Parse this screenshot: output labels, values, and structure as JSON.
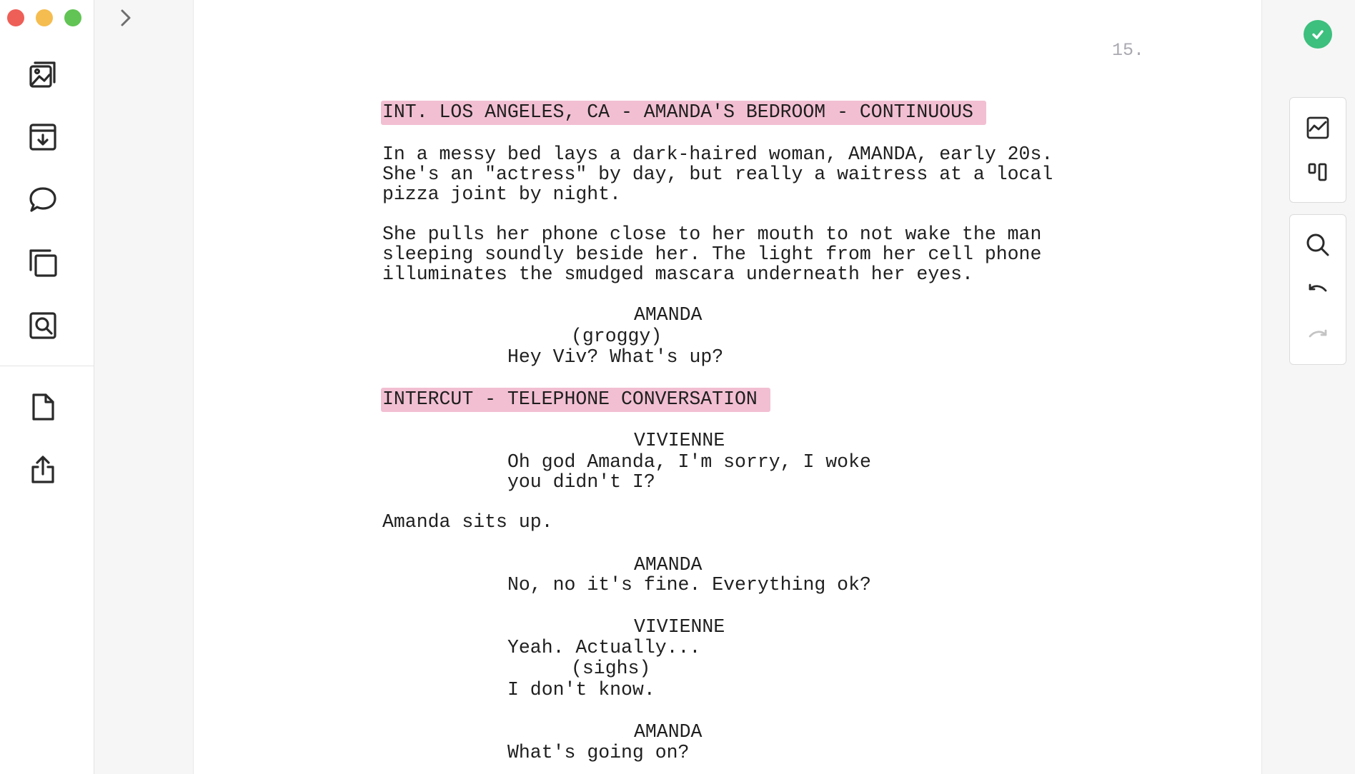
{
  "colors": {
    "scene_highlight": "#f2bfd2",
    "page_number": "#a9a9b0",
    "status_ok": "#3dbf7e",
    "text": "#1f1f1f"
  },
  "sidebar": {
    "items": [
      {
        "name": "images-icon"
      },
      {
        "name": "download-archive-icon"
      },
      {
        "name": "comment-icon"
      },
      {
        "name": "copy-icon"
      },
      {
        "name": "find-in-document-icon"
      },
      {
        "name": "document-icon"
      },
      {
        "name": "share-icon"
      }
    ]
  },
  "right_toolbar": {
    "status": "saved-check-icon",
    "group1": [
      "chart-icon",
      "layout-columns-icon"
    ],
    "group2": [
      "search-icon",
      "undo-icon",
      "redo-icon"
    ]
  },
  "script": {
    "page_number": "15.",
    "lines": [
      {
        "type": "scene",
        "text": "INT. LOS ANGELES, CA - AMANDA'S BEDROOM - CONTINUOUS"
      },
      {
        "type": "action",
        "text": "In a messy bed lays a dark-haired woman, AMANDA, early 20s."
      },
      {
        "type": "action",
        "text": "She's an \"actress\" by day, but really a waitress at a local"
      },
      {
        "type": "action",
        "text": "pizza joint by night."
      },
      {
        "type": "action",
        "text": "She pulls her phone close to her mouth to not wake the man"
      },
      {
        "type": "action",
        "text": "sleeping soundly beside her. The light from her cell phone"
      },
      {
        "type": "action",
        "text": "illuminates the smudged mascara underneath her eyes."
      },
      {
        "type": "character",
        "text": "AMANDA"
      },
      {
        "type": "parenthetical",
        "text": "(groggy)"
      },
      {
        "type": "dialogue",
        "text": "Hey Viv? What's up?"
      },
      {
        "type": "scene",
        "text": "INTERCUT - TELEPHONE CONVERSATION"
      },
      {
        "type": "character",
        "text": "VIVIENNE"
      },
      {
        "type": "dialogue",
        "text": "Oh god Amanda, I'm sorry, I woke"
      },
      {
        "type": "dialogue",
        "text": "you didn't I?"
      },
      {
        "type": "action",
        "text": "Amanda sits up."
      },
      {
        "type": "character",
        "text": "AMANDA"
      },
      {
        "type": "dialogue",
        "text": "No, no it's fine. Everything ok?"
      },
      {
        "type": "character",
        "text": "VIVIENNE"
      },
      {
        "type": "dialogue",
        "text": "Yeah. Actually..."
      },
      {
        "type": "parenthetical",
        "text": "(sighs)"
      },
      {
        "type": "dialogue",
        "text": "I don't know."
      },
      {
        "type": "character",
        "text": "AMANDA"
      },
      {
        "type": "dialogue",
        "text": "What's going on?"
      }
    ]
  }
}
